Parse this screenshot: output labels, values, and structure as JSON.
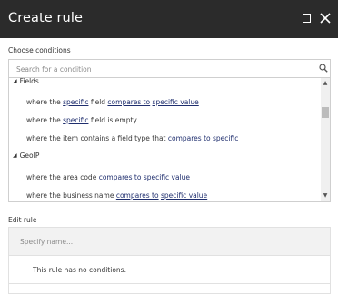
{
  "dialog": {
    "title": "Create rule"
  },
  "choose_conditions": {
    "label": "Choose conditions",
    "search_placeholder": "Search for a condition",
    "groups": [
      {
        "name": "Fields",
        "items": [
          [
            {
              "t": "where the ",
              "link": false
            },
            {
              "t": "specific",
              "link": true
            },
            {
              "t": " field ",
              "link": false
            },
            {
              "t": "compares to",
              "link": true
            },
            {
              "t": " ",
              "link": false
            },
            {
              "t": "specific value",
              "link": true
            }
          ],
          [
            {
              "t": "where the ",
              "link": false
            },
            {
              "t": "specific",
              "link": true
            },
            {
              "t": " field is empty",
              "link": false
            }
          ],
          [
            {
              "t": "where the item contains a field type that ",
              "link": false
            },
            {
              "t": "compares to",
              "link": true
            },
            {
              "t": " ",
              "link": false
            },
            {
              "t": "specific",
              "link": true
            }
          ]
        ]
      },
      {
        "name": "GeoIP",
        "items": [
          [
            {
              "t": "where the area code ",
              "link": false
            },
            {
              "t": "compares to",
              "link": true
            },
            {
              "t": " ",
              "link": false
            },
            {
              "t": "specific value",
              "link": true
            }
          ],
          [
            {
              "t": "where the business name ",
              "link": false
            },
            {
              "t": "compares to",
              "link": true
            },
            {
              "t": " ",
              "link": false
            },
            {
              "t": "specific value",
              "link": true
            }
          ]
        ]
      }
    ]
  },
  "edit_rule": {
    "label": "Edit rule",
    "name_placeholder": "Specify name...",
    "empty_message": "This rule has no conditions."
  },
  "icons": {
    "maximize": "maximize-icon",
    "close": "close-icon",
    "search": "search-icon",
    "expand": "triangle-down-icon"
  },
  "colors": {
    "titlebar_bg": "#2b2b2b",
    "link": "#1f2e6e"
  }
}
